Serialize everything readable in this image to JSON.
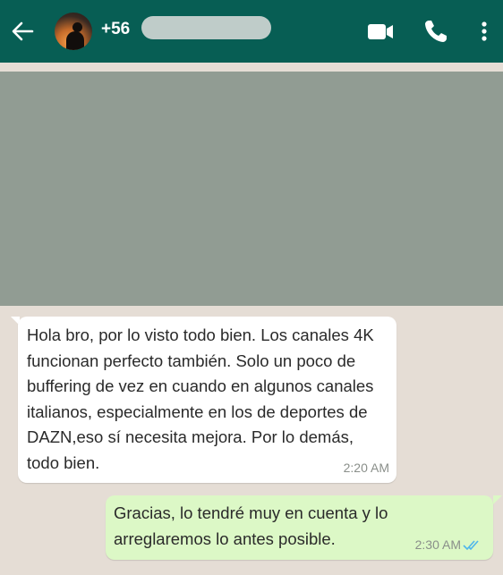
{
  "header": {
    "contact_prefix": "+56",
    "icons": [
      "back-arrow-icon",
      "video-call-icon",
      "phone-icon",
      "more-vertical-icon"
    ]
  },
  "messages": [
    {
      "direction": "incoming",
      "text": "Hola bro, por lo visto todo bien. Los canales 4K funcionan perfecto también. Solo un poco de buffering de vez en cuando en algunos canales italianos, especialmente en los de deportes de DAZN,eso sí necesita mejora. Por lo demás, todo bien.",
      "time": "2:20 AM"
    },
    {
      "direction": "outgoing",
      "text": "Gracias, lo tendré muy en cuenta y lo arreglaremos lo antes posible.",
      "time": "2:30 AM",
      "status": "read-double-check-icon"
    }
  ],
  "colors": {
    "header": "#075e54",
    "chat_bg": "#e5ddd5",
    "outgoing_bubble": "#dcf8c6",
    "incoming_bubble": "#ffffff",
    "read_ticks": "#4fb6ec"
  }
}
